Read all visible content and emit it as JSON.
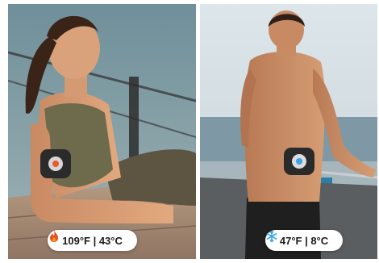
{
  "left_photo": {
    "subject": "woman-wearing-arm-heating-device",
    "badge": {
      "icon": "flame-icon",
      "text": "109°F | 43°C",
      "icon_color": "#e8501e"
    }
  },
  "right_photo": {
    "subject": "man-wearing-back-cooling-device",
    "badge": {
      "icon": "snowflake-icon",
      "text": "47°F | 8°C",
      "icon_color": "#3aa6e8"
    }
  }
}
